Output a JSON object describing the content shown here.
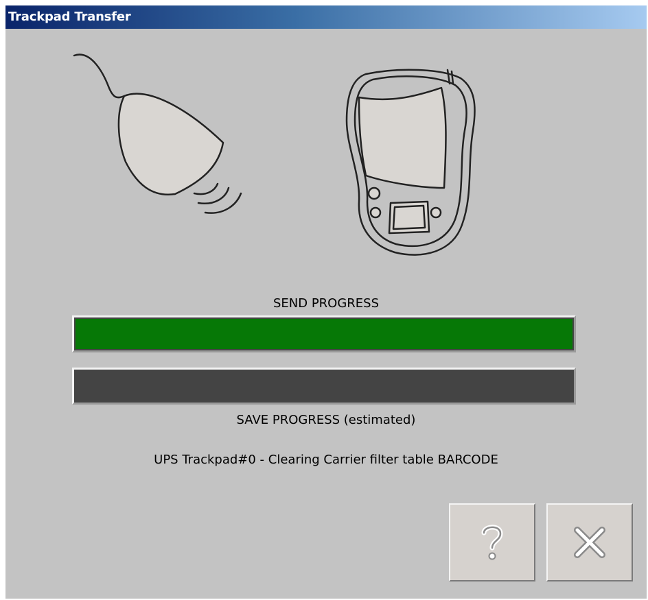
{
  "window": {
    "title": "Trackpad Transfer"
  },
  "progress": {
    "send": {
      "label": "SEND PROGRESS",
      "fraction": 1.0,
      "color": "#067806"
    },
    "save": {
      "label": "SAVE PROGRESS (estimated)",
      "fraction": 0.0,
      "color": "#067806"
    }
  },
  "status": {
    "text": "UPS Trackpad#0  - Clearing Carrier filter table BARCODE"
  },
  "buttons": {
    "help": {
      "icon": "question-mark-icon"
    },
    "close": {
      "icon": "close-x-icon"
    }
  },
  "icons": {
    "scanner": "scanner-icon",
    "device": "handheld-device-icon"
  }
}
